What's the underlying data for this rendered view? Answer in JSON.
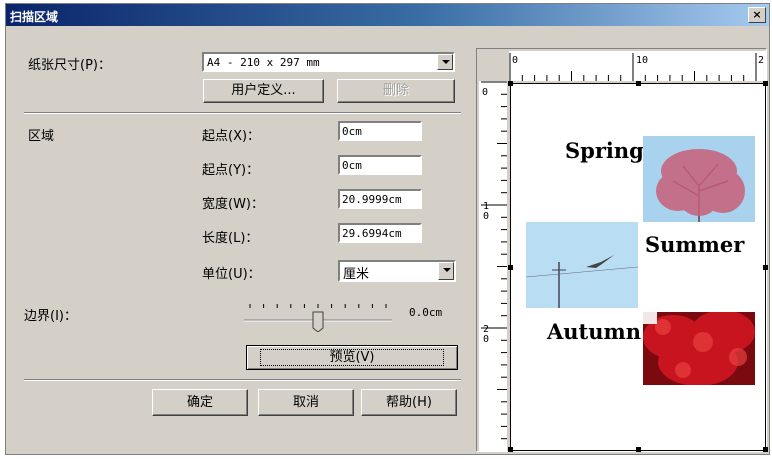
{
  "title": "扫描区域",
  "close_glyph": "×",
  "paper_size": {
    "label": "纸张尺寸(P)：",
    "value": "A4 - 210 x 297 mm"
  },
  "buttons": {
    "custom": "用户定义...",
    "delete": "删除",
    "preview": "预览(V)",
    "ok": "确定",
    "cancel": "取消",
    "help": "帮助(H)"
  },
  "area": {
    "label": "区域",
    "start_x": {
      "label": "起点(X)：",
      "value": "0cm"
    },
    "start_y": {
      "label": "起点(Y)：",
      "value": "0cm"
    },
    "width": {
      "label": "宽度(W)：",
      "value": "20.9999cm"
    },
    "height": {
      "label": "长度(L)：",
      "value": "29.6994cm"
    },
    "unit": {
      "label": "单位(U)：",
      "value": "厘米"
    }
  },
  "border": {
    "label": "边界(I)：",
    "value": "0.0cm",
    "slider_fraction": 0.5
  },
  "ruler": {
    "h_labels": [
      "0",
      "10",
      "2"
    ],
    "v_labels": [
      "0",
      "10",
      "20"
    ]
  },
  "preview": {
    "seasons": [
      "Spring",
      "Summer",
      "Autumn"
    ]
  },
  "colors": {
    "title_start": "#0a246a",
    "title_end": "#a6caf0",
    "face": "#d4d0c8",
    "sky": "#a9d2ee",
    "blossom": "#c8607a",
    "autumn_red": "#c8141e"
  }
}
